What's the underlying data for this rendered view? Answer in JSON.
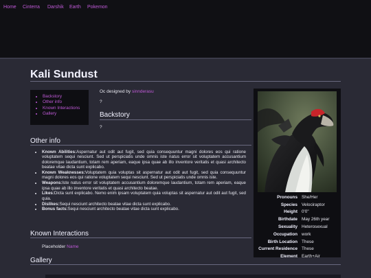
{
  "nav": [
    "Home",
    "Cinterra",
    "Darshik",
    "Earth",
    "Pokemon"
  ],
  "page_title": "Kali Sundust",
  "toc": [
    "Backstory",
    "Other info",
    "Known Interactions",
    "Gallery"
  ],
  "credit": {
    "prefix": "Oc designed by",
    "link": "sinnderasu"
  },
  "backstory": {
    "heading": "Backstory",
    "q_top": "?",
    "q_body": "?"
  },
  "other_info": {
    "heading": "Other info",
    "items": [
      {
        "label": "Known Abilities:",
        "text": "Aspernatur aut odit aut fugit, sed quia consequuntur magni dolores eos qui ratione voluptatem sequi nesciunt. Sed ut perspiciatis unde omnis iste natus error sit voluptatem accusantium doloremque laudantium, totam rem aperiam, eaque ipsa quae ab illo inventore veritatis et quasi architecto beatae vitae dicta sunt explicabo."
      },
      {
        "label": "Known Weaknesses:",
        "text": "Voluptatem quia voluptas sit aspernatur aut odit aut fugit, sed quia consequuntur magni dolores eos qui ratione voluptatem sequi nesciunt. Sed ut perspiciatis unde omnis iste."
      },
      {
        "label": "Weapons:",
        "text": "Iste natus error sit voluptatem accusantium doloremque laudantium, totam rem aperiam, eaque ipsa quae ab illo inventore veritatis et quasi architecto beatae."
      },
      {
        "label": "Likes:",
        "text": "Dicta sunt explicabo. Nemo enim ipsam voluptatem quia voluptas sit aspernatur aut odit aut fugit, sed quia."
      },
      {
        "label": "Dislikes:",
        "text": "Sequi nesciunt architecto beatae vitae dicta sunt explicabo."
      },
      {
        "label": "Bonus facts:",
        "text": "Sequi nesciunt architecto beatae vitae dicta sunt explicabo."
      }
    ]
  },
  "known_interactions": {
    "heading": "Known Interactions",
    "placeholder": "Placeholder",
    "link": "Name"
  },
  "gallery": {
    "heading": "Gallery"
  },
  "infobox": [
    {
      "k": "Pronouns",
      "v": "She/Her"
    },
    {
      "k": "Species",
      "v": "Velociraptor"
    },
    {
      "k": "Height",
      "v": "0'0\""
    },
    {
      "k": "Birthdate",
      "v": "May 26th year"
    },
    {
      "k": "Sexuality",
      "v": "Heterosexual"
    },
    {
      "k": "Occupation",
      "v": "work"
    },
    {
      "k": "Birth Location",
      "v": "These"
    },
    {
      "k": "Current Residence",
      "v": "These"
    },
    {
      "k": "Element",
      "v": "Earth+Air"
    }
  ],
  "colors": {
    "link": "#c05ad8",
    "bg": "#2a2a35",
    "panel": "#0e0e12"
  }
}
